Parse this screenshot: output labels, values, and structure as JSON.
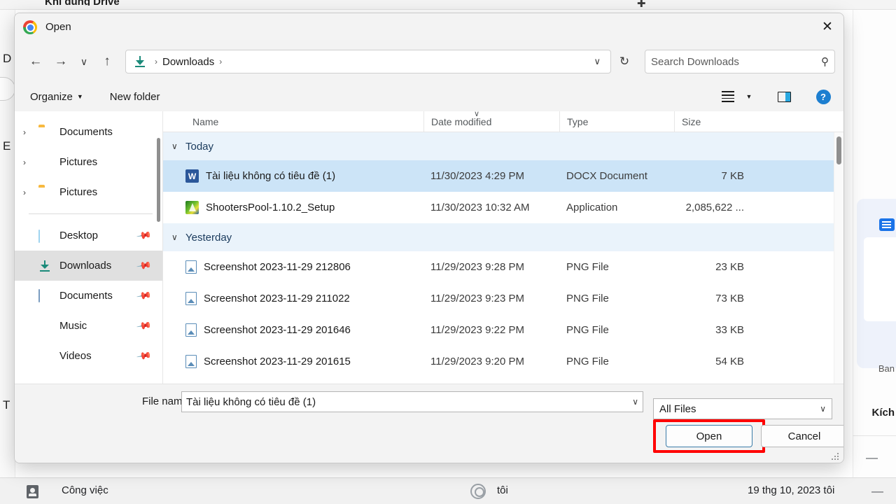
{
  "background": {
    "top_title": "Khi dùng Drive",
    "left_glyphs": [
      "D",
      "E",
      "T"
    ],
    "right_panel": {
      "label_partial": "Ban",
      "kich_label": "Kích",
      "dash": "—"
    },
    "bottom_bar": {
      "work_label": "Công việc",
      "user_label": "tôi",
      "date_label": "19 thg 10, 2023 tôi",
      "dash": "—"
    }
  },
  "dialog": {
    "title": "Open",
    "close_label": "✕",
    "nav": {
      "back": "←",
      "forward": "→",
      "recent": "∨",
      "up": "↑",
      "refresh": "↻",
      "breadcrumb": [
        "Downloads"
      ],
      "breadcrumb_separator": "›",
      "address_chevron": "∨"
    },
    "search": {
      "placeholder": "Search Downloads",
      "value": "",
      "icon": "⚲"
    },
    "command_bar": {
      "organize": "Organize",
      "organize_caret": "▼",
      "new_folder": "New folder",
      "view_caret": "▼",
      "help": "?"
    },
    "sidebar": {
      "tree_items": [
        {
          "label": "Documents",
          "icon": "folder-icon",
          "chevron": "›"
        },
        {
          "label": "Pictures",
          "icon": "pictures-icon",
          "chevron": "›"
        },
        {
          "label": "Pictures",
          "icon": "folder-icon",
          "chevron": "›"
        }
      ],
      "pinned_items": [
        {
          "label": "Desktop",
          "icon": "desktop-icon",
          "pinned": true,
          "active": false
        },
        {
          "label": "Downloads",
          "icon": "download-icon",
          "pinned": true,
          "active": true
        },
        {
          "label": "Documents",
          "icon": "document-icon",
          "pinned": true,
          "active": false
        },
        {
          "label": "Music",
          "icon": "music-icon",
          "pinned": true,
          "active": false
        },
        {
          "label": "Videos",
          "icon": "video-icon",
          "pinned": true,
          "active": false
        }
      ],
      "pin_glyph": "📌"
    },
    "file_list": {
      "columns": [
        "Name",
        "Date modified",
        "Type",
        "Size"
      ],
      "sort_indicator": "∨",
      "groups": [
        {
          "label": "Today",
          "chevron": "∨",
          "files": [
            {
              "name": "Tài liệu không có tiêu đề (1)",
              "date_modified": "11/30/2023 4:29 PM",
              "type": "DOCX Document",
              "size": "7 KB",
              "icon": "word-icon",
              "selected": true
            },
            {
              "name": "ShootersPool-1.10.2_Setup",
              "date_modified": "11/30/2023 10:32 AM",
              "type": "Application",
              "size": "2,085,622 ...",
              "icon": "application-icon",
              "selected": false
            }
          ]
        },
        {
          "label": "Yesterday",
          "chevron": "∨",
          "files": [
            {
              "name": "Screenshot 2023-11-29 212806",
              "date_modified": "11/29/2023 9:28 PM",
              "type": "PNG File",
              "size": "23 KB",
              "icon": "png-icon",
              "selected": false
            },
            {
              "name": "Screenshot 2023-11-29 211022",
              "date_modified": "11/29/2023 9:23 PM",
              "type": "PNG File",
              "size": "73 KB",
              "icon": "png-icon",
              "selected": false
            },
            {
              "name": "Screenshot 2023-11-29 201646",
              "date_modified": "11/29/2023 9:22 PM",
              "type": "PNG File",
              "size": "33 KB",
              "icon": "png-icon",
              "selected": false
            },
            {
              "name": "Screenshot 2023-11-29 201615",
              "date_modified": "11/29/2023 9:20 PM",
              "type": "PNG File",
              "size": "54 KB",
              "icon": "png-icon",
              "selected": false
            }
          ]
        }
      ]
    },
    "footer": {
      "file_name_label": "File name:",
      "file_name_value": "Tài liệu không có tiêu đề (1)",
      "file_name_caret": "∨",
      "filter_value": "All Files",
      "filter_caret": "∨",
      "open_button": "Open",
      "cancel_button": "Cancel"
    }
  },
  "colors": {
    "selection": "#cce4f7",
    "group_header": "#eaf3fb",
    "annotation": "#ff0000",
    "accent": "#1d7fd0",
    "sidebar_active": "#e0e0e0"
  }
}
